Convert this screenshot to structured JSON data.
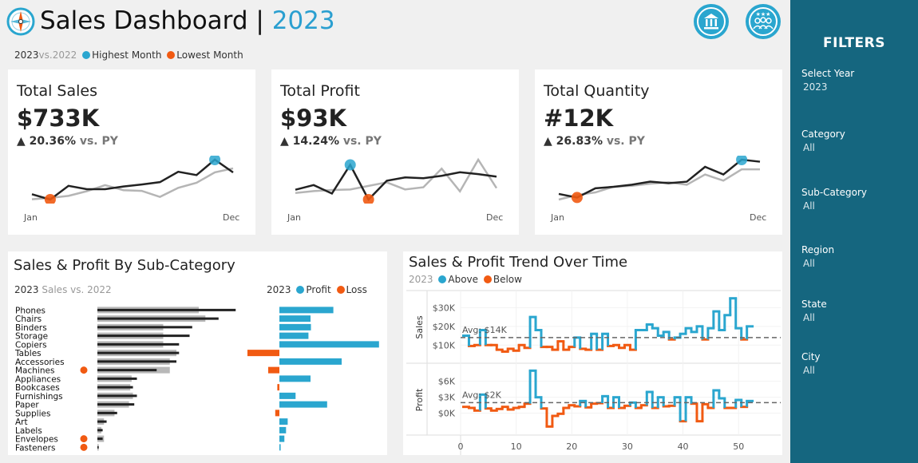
{
  "header": {
    "title": "Sales Dashboard",
    "separator": "|",
    "year": "2023",
    "legend": {
      "current_year": "2023",
      "vs": "vs.",
      "prior_year": "2022",
      "highest_label": "Highest Month",
      "lowest_label": "Lowest Month"
    },
    "icons": [
      "bank-icon",
      "people-icon"
    ]
  },
  "colors": {
    "accent": "#2aa6cf",
    "lowest": "#f15a12",
    "current_line": "#222222",
    "prior_line": "#b5b5b5",
    "sidebar": "#15667f"
  },
  "kpis": [
    {
      "title": "Total Sales",
      "value": "$733K",
      "arrow": "▲",
      "delta": "20.36%",
      "vs_label": "vs. PY",
      "start_label": "Jan",
      "end_label": "Dec",
      "current": [
        53,
        37,
        78,
        68,
        68,
        76,
        82,
        89,
        120,
        110,
        156,
        118
      ],
      "prior": [
        38,
        42,
        48,
        62,
        80,
        65,
        63,
        45,
        72,
        87,
        118,
        130
      ],
      "high_index": 10,
      "low_index": 1
    },
    {
      "title": "Total Profit",
      "value": "$93K",
      "arrow": "▲",
      "delta": "14.24%",
      "vs_label": "vs. PY",
      "start_label": "Jan",
      "end_label": "Dec",
      "current": [
        4.8,
        6.5,
        3.4,
        13.9,
        1.2,
        8.1,
        9.3,
        9.0,
        9.9,
        11.2,
        10.5,
        9.6
      ],
      "prior": [
        3.6,
        4.3,
        4.7,
        4.9,
        6.2,
        7.5,
        4.9,
        5.7,
        12.5,
        4.2,
        15.8,
        5.4
      ],
      "high_index": 3,
      "low_index": 4
    },
    {
      "title": "Total Quantity",
      "value": "#12K",
      "arrow": "▲",
      "delta": "26.83%",
      "vs_label": "vs. PY",
      "start_label": "Jan",
      "end_label": "Dec",
      "current": [
        620,
        550,
        730,
        760,
        800,
        860,
        830,
        860,
        1150,
        1000,
        1290,
        1250
      ],
      "prior": [
        510,
        600,
        650,
        760,
        780,
        820,
        850,
        800,
        1000,
        880,
        1100,
        1100
      ],
      "high_index": 10,
      "low_index": 1
    }
  ],
  "subcategory_panel": {
    "title": "Sales & Profit By Sub-Category",
    "legend_left": {
      "year": "2023",
      "text": "Sales vs. 2022"
    },
    "legend_right": {
      "year": "2023",
      "profit": "Profit",
      "loss": "Loss"
    }
  },
  "trend_panel": {
    "title": "Sales & Profit Trend Over Time",
    "legend": {
      "year": "2023",
      "above": "Above",
      "below": "Below"
    }
  },
  "filters": {
    "heading": "FILTERS",
    "items": [
      {
        "label": "Select Year",
        "value": "2023"
      },
      {
        "label": "Category",
        "value": "All"
      },
      {
        "label": "Sub-Category",
        "value": "All"
      },
      {
        "label": "Region",
        "value": "All"
      },
      {
        "label": "State",
        "value": "All"
      },
      {
        "label": "City",
        "value": "All"
      }
    ]
  },
  "chart_data": [
    {
      "type": "bar",
      "title": "Sales & Profit By Sub-Category",
      "categories": [
        "Phones",
        "Chairs",
        "Binders",
        "Storage",
        "Copiers",
        "Tables",
        "Accessories",
        "Machines",
        "Appliances",
        "Bookcases",
        "Furnishings",
        "Paper",
        "Supplies",
        "Art",
        "Labels",
        "Envelopes",
        "Fasteners"
      ],
      "loss_markers": [
        false,
        false,
        false,
        false,
        false,
        false,
        false,
        true,
        false,
        false,
        false,
        false,
        false,
        false,
        false,
        true,
        true
      ],
      "series": [
        {
          "name": "2023",
          "values": [
            105,
            92,
            72,
            70,
            62,
            62,
            60,
            45,
            30,
            27,
            30,
            28,
            15,
            7,
            4,
            4,
            1
          ]
        },
        {
          "name": "2022",
          "values": [
            77,
            82,
            50,
            50,
            50,
            60,
            55,
            55,
            26,
            25,
            27,
            24,
            13,
            5,
            3,
            5,
            1
          ]
        },
        {
          "name": "Profit",
          "values": [
            13.0,
            7.5,
            7.6,
            7.0,
            24.0,
            -7.7,
            15.0,
            -2.7,
            7.5,
            -0.5,
            3.9,
            11.5,
            -1.0,
            2.0,
            1.6,
            1.2,
            0.3
          ]
        }
      ]
    },
    {
      "type": "line",
      "title": "Sales & Profit Trend Over Time",
      "x": [
        1,
        2,
        3,
        4,
        5,
        6,
        7,
        8,
        9,
        10,
        11,
        12,
        13,
        14,
        15,
        16,
        17,
        18,
        19,
        20,
        21,
        22,
        23,
        24,
        25,
        26,
        27,
        28,
        29,
        30,
        31,
        32,
        33,
        34,
        35,
        36,
        37,
        38,
        39,
        40,
        41,
        42,
        43,
        44,
        45,
        46,
        47,
        48,
        49,
        50,
        51,
        52
      ],
      "x_ticks": [
        0,
        10,
        20,
        30,
        40,
        50
      ],
      "series": [
        {
          "name": "Sales",
          "ylabel": "Sales",
          "y_ticks": [
            10000,
            20000,
            30000
          ],
          "y_tick_labels": [
            "$10K",
            "$20K",
            "$30K"
          ],
          "avg": 14000,
          "avg_label": "Avg: $14K",
          "values": [
            15000,
            9500,
            10000,
            18000,
            10000,
            10000,
            7500,
            6500,
            8000,
            7000,
            10000,
            8500,
            25000,
            18000,
            9000,
            9000,
            7500,
            12000,
            7500,
            9000,
            14000,
            8000,
            7500,
            16000,
            7500,
            16000,
            9500,
            10000,
            8500,
            10000,
            7500,
            18000,
            18000,
            21000,
            19000,
            15000,
            17000,
            13000,
            14000,
            16000,
            19000,
            17000,
            20000,
            13000,
            19000,
            28000,
            18000,
            26000,
            35000,
            19000,
            13000,
            20000
          ]
        },
        {
          "name": "Profit",
          "ylabel": "Profit",
          "y_ticks": [
            0,
            3000,
            6000
          ],
          "y_tick_labels": [
            "$0K",
            "$3K",
            "$6K"
          ],
          "avg": 2000,
          "avg_label": "Avg: $2K",
          "values": [
            1200,
            1000,
            500,
            3500,
            900,
            500,
            800,
            1200,
            700,
            1000,
            1200,
            1800,
            8000,
            3000,
            900,
            -2500,
            -500,
            -100,
            1000,
            1500,
            1300,
            2300,
            1100,
            1800,
            1900,
            3200,
            1000,
            3000,
            1000,
            1400,
            2000,
            1000,
            1500,
            4000,
            1000,
            3000,
            1300,
            1400,
            3000,
            -1500,
            3000,
            1800,
            -1500,
            1700,
            1000,
            4300,
            2800,
            1000,
            1000,
            2500,
            1200,
            2300
          ]
        }
      ]
    }
  ]
}
